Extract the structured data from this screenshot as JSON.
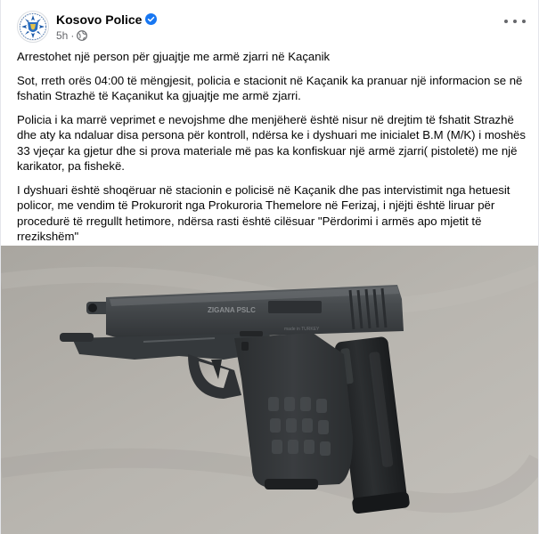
{
  "post": {
    "page_name": "Kosovo Police",
    "timestamp": "5h",
    "separator": "·",
    "verified_icon": "verified-badge-icon",
    "audience_icon": "globe-icon",
    "more_icon": "more-options-icon",
    "paragraphs": [
      "Arrestohet një person për gjuajtje me armë zjarri në Kaçanik",
      "Sot, rreth orës 04:00 të mëngjesit, policia e stacionit në Kaçanik ka pranuar një informacion se në fshatin Strazhë të Kaçanikut ka gjuajtje me armë zjarri.",
      "Policia i ka marrë veprimet e nevojshme dhe menjëherë është nisur në drejtim të fshatit  Strazhë dhe aty ka ndaluar disa persona për kontroll, ndërsa ke i dyshuari me inicialet B.M (M/K) i moshës 33 vjeçar ka gjetur dhe si prova materiale më pas ka konfiskuar një armë zjarri( pistoletë) me një karikator, pa fishekë.",
      "I dyshuari është shoqëruar në stacionin e policisë në Kaçanik dhe pas intervistimit nga hetuesit policor, me vendim të Prokurorit nga Prokuroria Themelore në Ferizaj, i njëjti është liruar për procedurë të rregullt hetimore, ndërsa rasti është cilësuar \"Përdorimi i armës apo mjetit të rrezikshëm\""
    ],
    "photo": {
      "slide_marking": "ZIGANA PSLC",
      "frame_marking": "made in TURKEY"
    }
  },
  "colors": {
    "verified_blue": "#1877f2",
    "meta_grey": "#65676b",
    "table_surface": "#b3b0aa",
    "pistol_body": "#3b3f42"
  }
}
